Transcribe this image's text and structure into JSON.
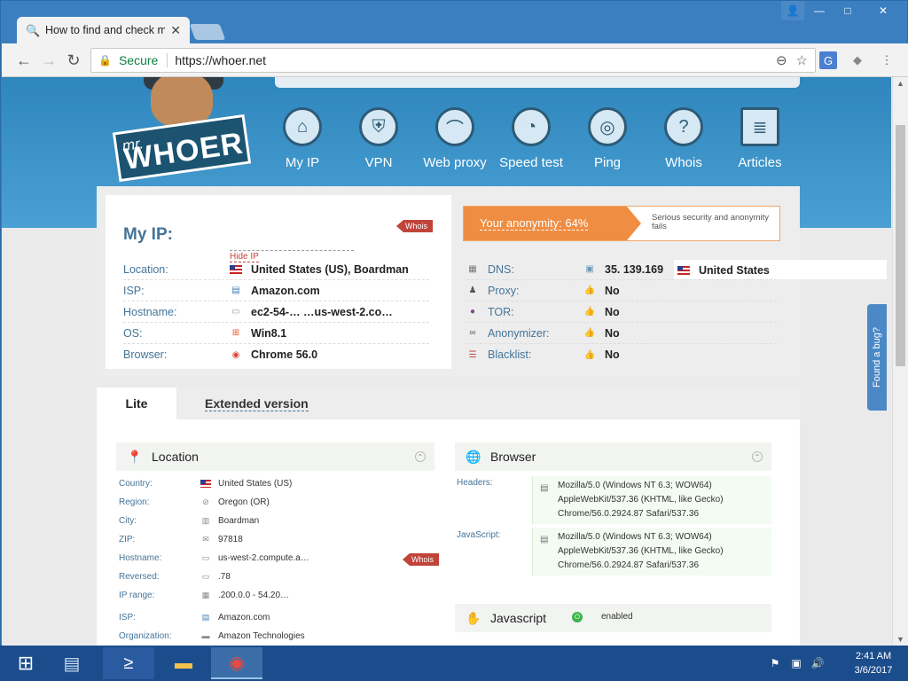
{
  "browser": {
    "tab_title": "How to find and check m",
    "secure_label": "Secure",
    "url": "https://whoer.net"
  },
  "site": {
    "logo_mr": "mr.",
    "logo_name": "WHOER",
    "nav": [
      {
        "label": "My IP",
        "icon": "home-icon"
      },
      {
        "label": "VPN",
        "icon": "shield-icon"
      },
      {
        "label": "Web proxy",
        "icon": "spy-hat-icon"
      },
      {
        "label": "Speed test",
        "icon": "gauge-icon"
      },
      {
        "label": "Ping",
        "icon": "target-icon"
      },
      {
        "label": "Whois",
        "icon": "question-icon"
      },
      {
        "label": "Articles",
        "icon": "document-icon"
      }
    ]
  },
  "myip": {
    "title": "My IP:",
    "whois_tag": "Whois",
    "hide_ip": "Hide IP",
    "rows": [
      {
        "key": "Location:",
        "value": "United States (US), Boardman",
        "icon": "us-flag-icon"
      },
      {
        "key": "ISP:",
        "value": "Amazon.com",
        "icon": "isp-icon"
      },
      {
        "key": "Hostname:",
        "value": "ec2-54-…   …us-west-2.co…",
        "icon": "server-icon"
      },
      {
        "key": "OS:",
        "value": "Win8.1",
        "icon": "windows-icon"
      },
      {
        "key": "Browser:",
        "value": "Chrome 56.0",
        "icon": "chrome-icon"
      }
    ]
  },
  "anonymity": {
    "label": "Your anonymity: 64%",
    "percent": 64,
    "message": "Serious security and anonymity fails",
    "color": "#ef8d42"
  },
  "checks": [
    {
      "key": "DNS:",
      "value": "35.   139.169",
      "extra": "United States",
      "icon": "dns-icon"
    },
    {
      "key": "Proxy:",
      "value": "No",
      "icon": "proxy-icon"
    },
    {
      "key": "TOR:",
      "value": "No",
      "icon": "tor-icon"
    },
    {
      "key": "Anonymizer:",
      "value": "No",
      "icon": "anonymizer-icon"
    },
    {
      "key": "Blacklist:",
      "value": "No",
      "icon": "blacklist-icon"
    }
  ],
  "tabs": {
    "lite": "Lite",
    "extended": "Extended version"
  },
  "location": {
    "title": "Location",
    "whois_tag": "Whois",
    "rows": [
      {
        "key": "Country:",
        "value": "United States (US)"
      },
      {
        "key": "Region:",
        "value": "Oregon (OR)"
      },
      {
        "key": "City:",
        "value": "Boardman"
      },
      {
        "key": "ZIP:",
        "value": "97818"
      },
      {
        "key": "Hostname:",
        "value": "         us-west-2.compute.a…"
      },
      {
        "key": "Reversed:",
        "value": "           .78"
      },
      {
        "key": "IP range:",
        "value": ".200.0.0 - 54.20…"
      },
      {
        "key": "ISP:",
        "value": "Amazon.com"
      },
      {
        "key": "Organization:",
        "value": "Amazon Technologies"
      }
    ]
  },
  "browser_section": {
    "title": "Browser",
    "headers_label": "Headers:",
    "headers_lines": [
      "Mozilla/5.0 (Windows NT 6.3; WOW64)",
      "AppleWebKit/537.36 (KHTML, like Gecko)",
      "Chrome/56.0.2924.87 Safari/537.36"
    ],
    "js_label": "JavaScript:",
    "js_lines": [
      "Mozilla/5.0 (Windows NT 6.3; WOW64)",
      "AppleWebKit/537.36 (KHTML, like Gecko)",
      "Chrome/56.0.2924.87 Safari/537.36"
    ]
  },
  "javascript": {
    "title": "Javascript",
    "status": "enabled"
  },
  "bug_tab": "Found a bug?",
  "taskbar": {
    "time": "2:41 AM",
    "date": "3/6/2017"
  }
}
